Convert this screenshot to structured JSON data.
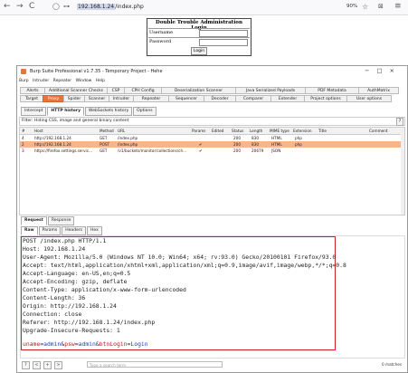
{
  "browser": {
    "back_icon": "←",
    "forward_icon": "→",
    "reload_icon": "C",
    "shield_icon": "◯",
    "lock_icon": "⊶",
    "url_host": "192.168.1.24",
    "url_path": "/index.php",
    "zoom": "90%",
    "star_icon": "☆",
    "extensions_icon": "⊠",
    "menu_icon": "≡"
  },
  "login": {
    "title": "Double Trouble Administration Login",
    "username_label": "Username",
    "password_label": "Password",
    "button": "Login"
  },
  "burp": {
    "title": "Burp Suite Professional v1.7.35 - Temporary Project - Hehe",
    "window_controls": [
      "−",
      "□",
      "×"
    ],
    "menu": [
      "Burp",
      "Intruder",
      "Repeater",
      "Window",
      "Help"
    ],
    "tabs_row1": [
      "Alerts",
      "Additional Scanner Checks",
      "CSP",
      "CPH Config",
      "Deserialization Scanner",
      "Java Serialized Payloads",
      "PDF Metadata",
      "AuthMatrix"
    ],
    "tabs_row2": [
      "Target",
      "Proxy",
      "Spider",
      "Scanner",
      "Intruder",
      "Repeater",
      "Sequencer",
      "Decoder",
      "Comparer",
      "Extender",
      "Project options",
      "User options"
    ],
    "proxy_tabs": [
      "Intercept",
      "HTTP history",
      "WebSockets history",
      "Options"
    ],
    "filter": "Filter: Hiding CSS, image and general binary content",
    "filter_help": "?",
    "history_headers": [
      "#",
      "Host",
      "Method",
      "URL",
      "Params",
      "Edited",
      "Status",
      "Length",
      "MIME type",
      "Extension",
      "Title",
      "Comment"
    ],
    "history_rows": [
      {
        "num": "4",
        "host": "http://192.168.1.24",
        "method": "GET",
        "url": "/index.php",
        "params": "",
        "status": "200",
        "length": "830",
        "mime": "HTML",
        "ext": "php"
      },
      {
        "num": "2",
        "host": "http://192.168.1.24",
        "method": "POST",
        "url": "/index.php",
        "params": "✔",
        "status": "200",
        "length": "830",
        "mime": "HTML",
        "ext": "php"
      },
      {
        "num": "3",
        "host": "https://firefox.settings.servic...",
        "method": "GET",
        "url": "/v1/buckets/monitor/collections/ch...",
        "params": "✔",
        "status": "200",
        "length": "20679",
        "mime": "JSON",
        "ext": ""
      }
    ],
    "rr_tabs": [
      "Request",
      "Response"
    ],
    "sub_tabs": [
      "Raw",
      "Params",
      "Headers",
      "Hex"
    ],
    "request_lines": [
      "POST /index.php HTTP/1.1",
      "Host: 192.168.1.24",
      "User-Agent: Mozilla/5.0 (Windows NT 10.0; Win64; x64; rv:93.0) Gecko/20100101 Firefox/93.0",
      "Accept: text/html,application/xhtml+xml,application/xml;q=0.9,image/avif,image/webp,*/*;q=0.8",
      "Accept-Language: en-US,en;q=0.5",
      "Accept-Encoding: gzip, deflate",
      "Content-Type: application/x-www-form-urlencoded",
      "Content-Length: 36",
      "Origin: http://192.168.1.24",
      "Connection: close",
      "Referer: http://192.168.1.24/index.php",
      "Upgrade-Insecure-Requests: 1"
    ],
    "body": {
      "k1": "uname",
      "v1": "admin",
      "k2": "psw",
      "v2": "admin",
      "k3": "btnLogin",
      "v3": "Login",
      "eq": "=",
      "amp": "&"
    },
    "bottom": {
      "help": "?",
      "prev": "<",
      "add": "+",
      "next": ">",
      "search_placeholder": "Type a search term",
      "matches": "0 matches"
    }
  },
  "colors": {
    "accent": "#e8743b",
    "selected_row": "#f6b58a",
    "highlight_border": "#d11f2f"
  }
}
